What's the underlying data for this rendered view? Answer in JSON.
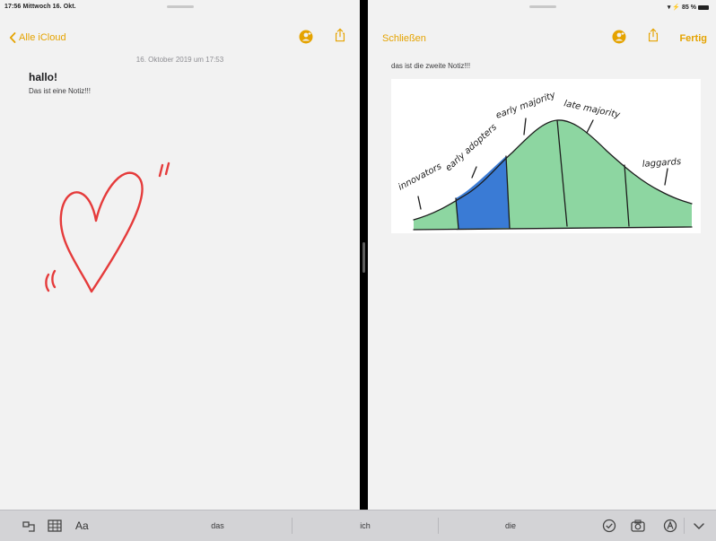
{
  "status": {
    "time_date": "17:56  Mittwoch 16. Okt.",
    "indicators": "▾ ⚡ 85 %"
  },
  "left": {
    "back_label": "Alle iCloud",
    "date": "16. Oktober 2019 um 17:53",
    "title": "hallo!",
    "body": "Das ist eine Notiz!!!",
    "drawing": "heart-sketch"
  },
  "right": {
    "close_label": "Schließen",
    "done_label": "Fertig",
    "body": "das ist die zweite Notiz!!!",
    "image": {
      "labels": [
        "innovators",
        "early adopters",
        "early majority",
        "late majority",
        "laggards"
      ],
      "colors": {
        "green": "#8dd6a1",
        "blue": "#3a7bd5"
      }
    }
  },
  "toolbar": {
    "format_label": "Aa",
    "suggestions": [
      "das",
      "ich",
      "die"
    ]
  },
  "colors": {
    "accent": "#e5a300",
    "heart": "#e53b3b",
    "background": "#f2f2f2",
    "toolbar": "#d3d3d6"
  },
  "icons": [
    "chevron-left-icon",
    "add-person-icon",
    "share-icon",
    "checklist-icon",
    "table-icon",
    "markup-icon",
    "camera-icon",
    "pen-icon",
    "hide-keyboard-icon"
  ]
}
